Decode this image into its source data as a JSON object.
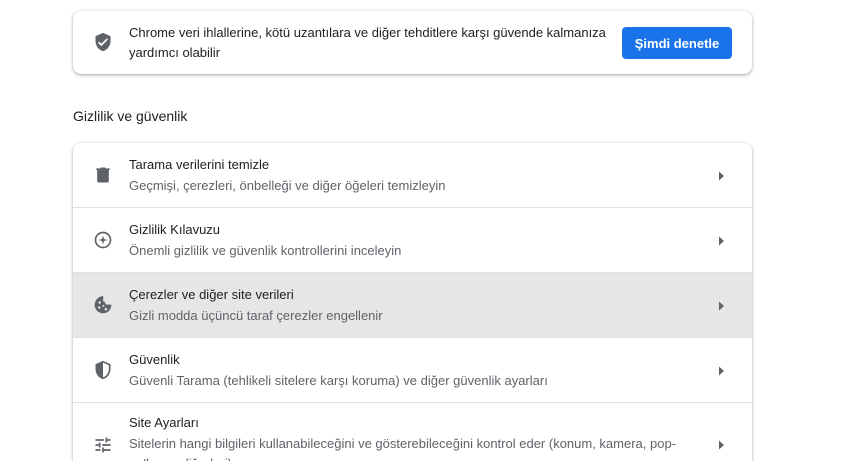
{
  "safety_check": {
    "text": "Chrome veri ihlallerine, kötü uzantılara ve diğer tehditlere karşı güvende kalmanıza yardımcı olabilir",
    "button_label": "Şimdi denetle",
    "icon": "shield-check-icon",
    "button_color": "#1a73e8"
  },
  "privacy_section": {
    "title": "Gizlilik ve güvenlik",
    "rows": [
      {
        "title": "Tarama verilerini temizle",
        "subtitle": "Geçmişi, çerezleri, önbelleği ve diğer öğeleri temizleyin",
        "icon": "trash-icon"
      },
      {
        "title": "Gizlilik Kılavuzu",
        "subtitle": "Önemli gizlilik ve güvenlik kontrollerini inceleyin",
        "icon": "privacy-guide-icon"
      },
      {
        "title": "Çerezler ve diğer site verileri",
        "subtitle": "Gizli modda üçüncü taraf çerezler engellenir",
        "icon": "cookie-icon",
        "highlighted": true
      },
      {
        "title": "Güvenlik",
        "subtitle": "Güvenli Tarama (tehlikeli sitelere karşı koruma) ve diğer güvenlik ayarları",
        "icon": "security-shield-icon"
      },
      {
        "title": "Site Ayarları",
        "subtitle": "Sitelerin hangi bilgileri kullanabileceğini ve gösterebileceğini kontrol eder (konum, kamera, pop-up'lar ve diğerleri)",
        "icon": "tune-icon"
      }
    ]
  },
  "colors": {
    "accent": "#1a73e8",
    "icon": "#5f6368",
    "highlight_row": "#e6e6e6"
  }
}
